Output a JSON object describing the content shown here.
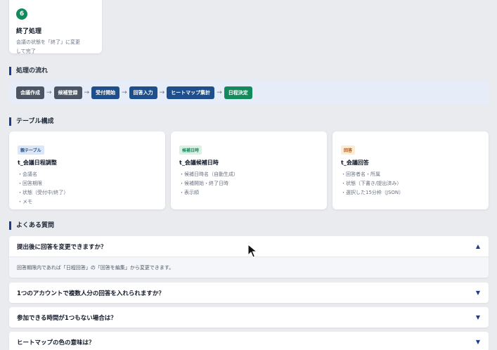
{
  "step": {
    "number": "6",
    "title": "終了処理",
    "desc_line1": "会議の状態を「終了」に変更",
    "desc_line2": "して完了"
  },
  "flow": {
    "title": "処理の流れ",
    "steps": [
      {
        "label": "会議作成",
        "color": "#4b5563"
      },
      {
        "label": "候補登録",
        "color": "#4b5563"
      },
      {
        "label": "受付開始",
        "color": "#1e4f8c"
      },
      {
        "label": "回答入力",
        "color": "#1e4f8c"
      },
      {
        "label": "ヒートマップ集計",
        "color": "#1e4f8c"
      },
      {
        "label": "日程決定",
        "color": "#138a5b"
      }
    ],
    "arrow": "→"
  },
  "tables": {
    "title": "テーブル構成",
    "items": [
      {
        "tag": "親テーブル",
        "tag_color": "#1e4f8c",
        "tag_bg": "#dbe7f6",
        "name": "t_会議日程調整",
        "fields": [
          "会議名",
          "回答期限",
          "状態（受付中/終了）",
          "メモ"
        ]
      },
      {
        "tag": "候補日時",
        "tag_color": "#138a5b",
        "tag_bg": "#dcf1e6",
        "name": "t_会議候補日時",
        "fields": [
          "候補日時名（自動生成）",
          "候補開始・終了日時",
          "表示順"
        ]
      },
      {
        "tag": "回答",
        "tag_color": "#b45309",
        "tag_bg": "#fdebd3",
        "name": "t_会議回答",
        "fields": [
          "回答者名・所属",
          "状態（下書き/提出済み）",
          "選択した15分枠（JSON）"
        ]
      }
    ]
  },
  "faq": {
    "title": "よくある質問",
    "items": [
      {
        "q": "提出後に回答を変更できますか？",
        "a": "回答期限内であれば「日程回答」の「回答を編集」から変更できます。",
        "open": true,
        "caret": "▲"
      },
      {
        "q": "1つのアカウントで複数人分の回答を入れられますか？",
        "open": false,
        "caret": "▼"
      },
      {
        "q": "参加できる時間が1つもない場合は？",
        "open": false,
        "caret": "▼"
      },
      {
        "q": "ヒートマップの色の意味は？",
        "open": false,
        "caret": "▼"
      }
    ]
  },
  "colors": {
    "accent": "#1e3a8a",
    "green": "#138a5b",
    "background": "#e9ebef"
  }
}
